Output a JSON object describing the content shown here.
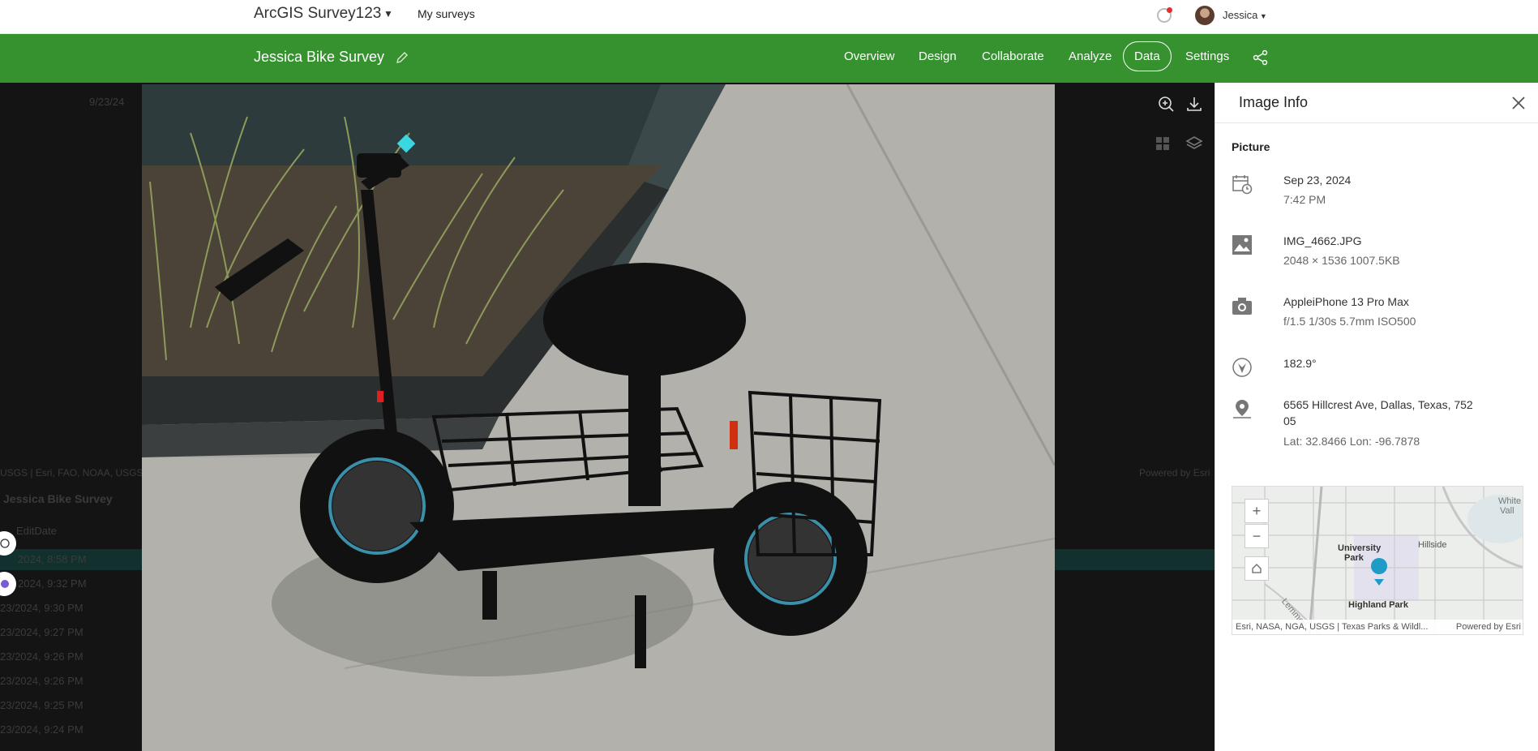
{
  "header": {
    "app_title": "ArcGIS Survey123",
    "my_surveys": "My surveys",
    "user_name": "Jessica"
  },
  "survey": {
    "title": "Jessica Bike Survey",
    "nav": [
      "Overview",
      "Design",
      "Collaborate",
      "Analyze",
      "Data",
      "Settings"
    ],
    "active_tab": "Data"
  },
  "background": {
    "toolbar_date": "9/23/24",
    "map_credit": "USGS | Esri, FAO, NOAA, USGS",
    "powered": "Powered by Esri",
    "table_title": "Jessica Bike Survey",
    "column": "EditDate",
    "rows": [
      "2024, 8:58 PM",
      "2024, 9:32 PM",
      "23/2024, 9:30 PM",
      "23/2024, 9:27 PM",
      "23/2024, 9:26 PM",
      "23/2024, 9:26 PM",
      "23/2024, 9:25 PM",
      "23/2024, 9:24 PM"
    ]
  },
  "panel": {
    "title": "Image Info",
    "section": "Picture",
    "date": "Sep 23, 2024",
    "time": "7:42 PM",
    "filename": "IMG_4662.JPG",
    "dims": "2048 × 1536   1007.5KB",
    "camera": "AppleiPhone 13 Pro Max",
    "exif": "f/1.5   1/30s   5.7mm   ISO500",
    "heading": "182.9°",
    "address_line1": "6565 Hillcrest Ave, Dallas, Texas, 752",
    "address_line2": "05",
    "latlon": "Lat: 32.8466   Lon: -96.7878"
  },
  "map": {
    "labels": {
      "univ1": "University",
      "univ2": "Park",
      "hillside": "Hillside",
      "highland": "Highland Park",
      "lemmon": "Lemmon",
      "white": "White",
      "valley": "Vall"
    },
    "attribution": "Esri, NASA, NGA, USGS | Texas Parks & Wildl...",
    "powered": "Powered by Esri",
    "marker_color": "#1f9bc7"
  },
  "colors": {
    "brand_green": "#35922f"
  }
}
